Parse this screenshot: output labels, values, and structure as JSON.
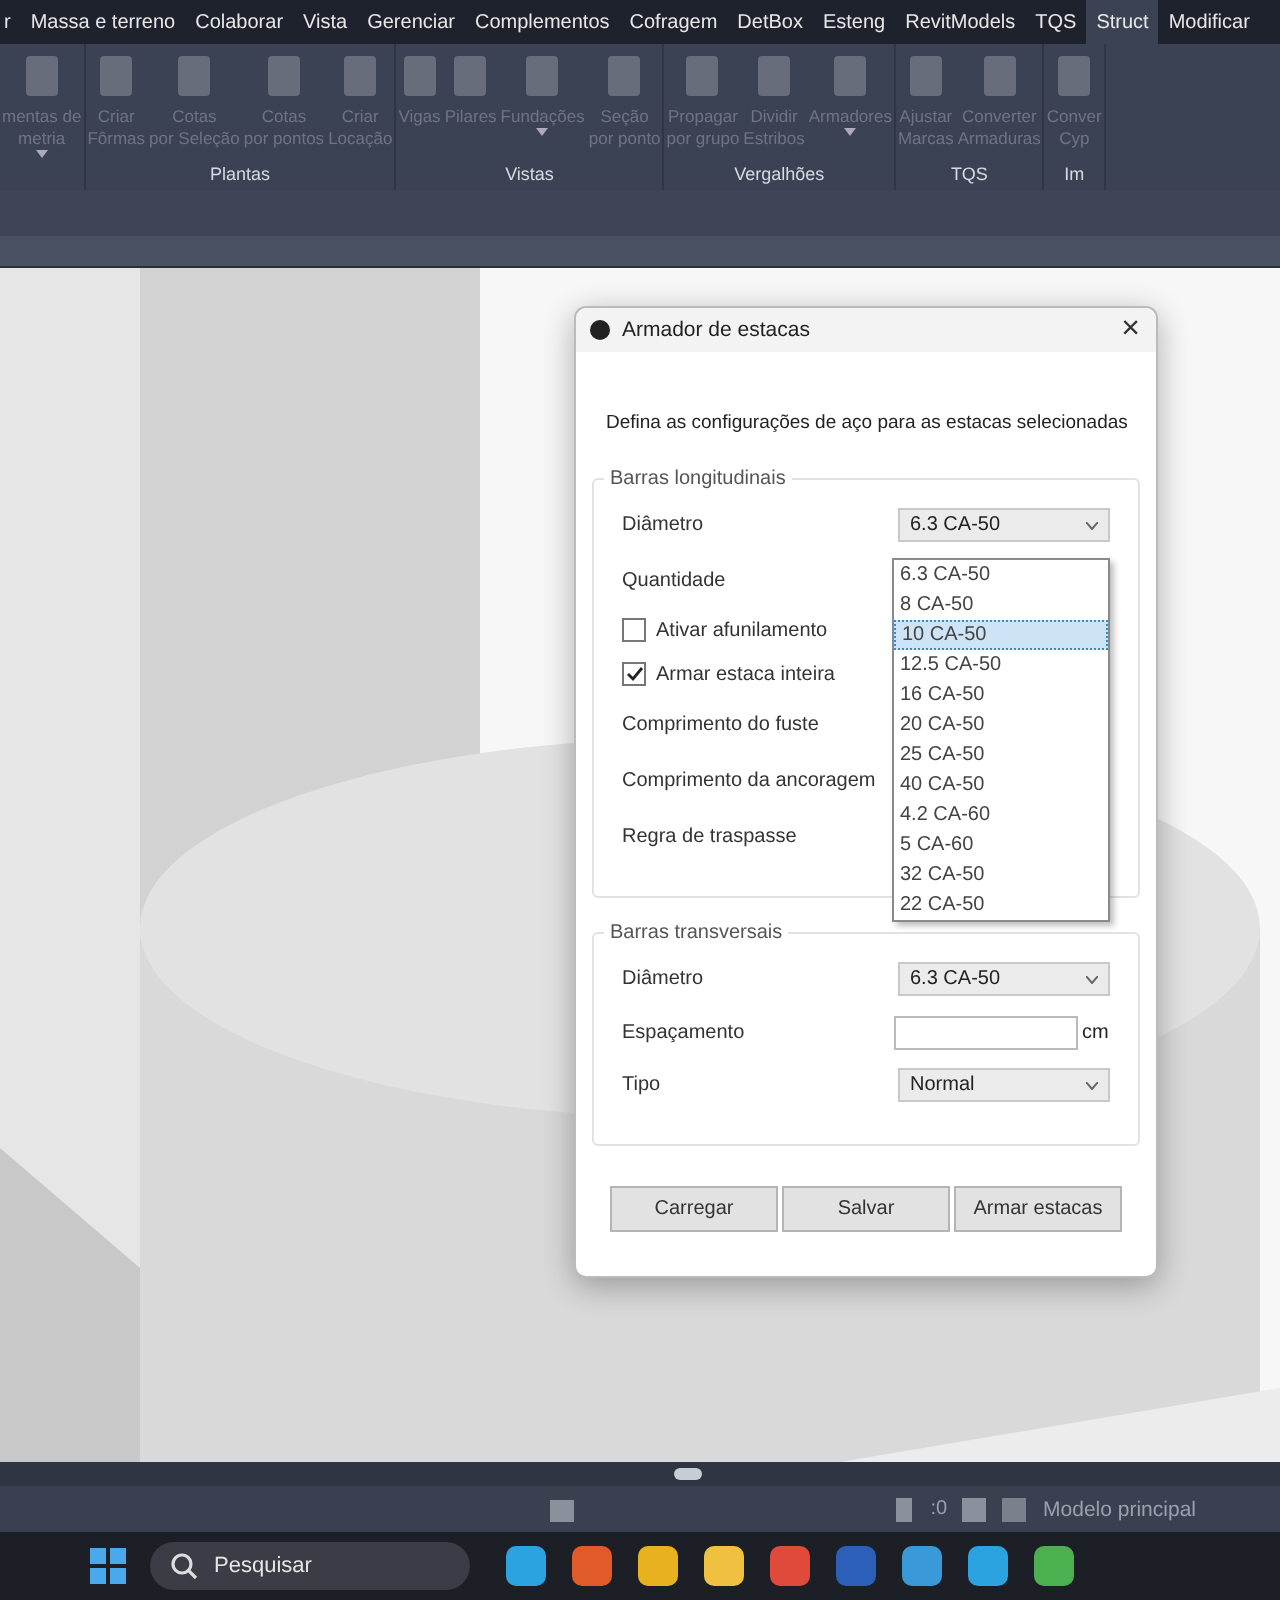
{
  "menu": [
    {
      "label": "r",
      "selected": false
    },
    {
      "label": "Massa e terreno",
      "selected": false
    },
    {
      "label": "Colaborar",
      "selected": false
    },
    {
      "label": "Vista",
      "selected": false
    },
    {
      "label": "Gerenciar",
      "selected": false
    },
    {
      "label": "Complementos",
      "selected": false
    },
    {
      "label": "Cofragem",
      "selected": false
    },
    {
      "label": "DetBox",
      "selected": false
    },
    {
      "label": "Esteng",
      "selected": false
    },
    {
      "label": "RevitModels",
      "selected": false
    },
    {
      "label": "TQS",
      "selected": false
    },
    {
      "label": "Struct",
      "selected": true
    },
    {
      "label": "Modificar",
      "selected": false
    }
  ],
  "ribbon": [
    {
      "tools": [
        {
          "lines": [
            "mentas de",
            "metria"
          ],
          "caret": true,
          "disabled": true
        }
      ]
    },
    {
      "label": "Plantas",
      "tools": [
        {
          "lines": [
            "Criar",
            "Fôrmas"
          ],
          "caret": false,
          "disabled": true
        },
        {
          "lines": [
            "Cotas",
            "por Seleção"
          ],
          "caret": false,
          "disabled": true
        },
        {
          "lines": [
            "Cotas",
            "por pontos"
          ],
          "caret": false,
          "disabled": true
        },
        {
          "lines": [
            "Criar",
            "Locação"
          ],
          "caret": false,
          "disabled": true
        }
      ]
    },
    {
      "label": "Vistas",
      "tools": [
        {
          "lines": [
            "Vigas"
          ],
          "caret": false,
          "disabled": true
        },
        {
          "lines": [
            "Pilares"
          ],
          "caret": false,
          "disabled": true
        },
        {
          "lines": [
            "Fundações"
          ],
          "caret": true,
          "disabled": true
        },
        {
          "lines": [
            "Seção",
            "por ponto"
          ],
          "caret": false,
          "disabled": true
        }
      ]
    },
    {
      "label": "Vergalhões",
      "tools": [
        {
          "lines": [
            "Propagar",
            "por grupo"
          ],
          "caret": false,
          "disabled": true
        },
        {
          "lines": [
            "Dividir",
            "Estribos"
          ],
          "caret": false,
          "disabled": true
        },
        {
          "lines": [
            "Armadores"
          ],
          "caret": true,
          "disabled": true
        }
      ]
    },
    {
      "label": "TQS",
      "tools": [
        {
          "lines": [
            "Ajustar",
            "Marcas"
          ],
          "caret": false,
          "disabled": true
        },
        {
          "lines": [
            "Converter",
            "Armaduras"
          ],
          "caret": false,
          "disabled": true
        }
      ]
    },
    {
      "label": "Im",
      "tools": [
        {
          "lines": [
            "Conver",
            "Cyp"
          ],
          "caret": false,
          "disabled": true
        }
      ]
    }
  ],
  "dialog": {
    "title": "Armador de estacas",
    "close": "×",
    "description": "Defina as configurações de aço para as estacas selecionadas",
    "groups": [
      {
        "legend": "Barras longitudinais",
        "rows": [
          {
            "kind": "combo",
            "label": "Diâmetro",
            "value": "6.3 CA-50"
          },
          {
            "kind": "label",
            "label": "Quantidade"
          },
          {
            "kind": "checkbox",
            "label": "Ativar afunilamento",
            "checked": false
          },
          {
            "kind": "checkbox",
            "label": "Armar estaca inteira",
            "checked": true
          },
          {
            "kind": "label",
            "label": "Comprimento do fuste"
          },
          {
            "kind": "label",
            "label": "Comprimento da ancoragem"
          },
          {
            "kind": "label",
            "label": "Regra de traspasse"
          }
        ]
      },
      {
        "legend": "Barras transversais",
        "rows": [
          {
            "kind": "combo",
            "label": "Diâmetro",
            "value": "6.3 CA-50"
          },
          {
            "kind": "field",
            "label": "Espaçamento",
            "unit": "cm"
          },
          {
            "kind": "combo",
            "label": "Tipo",
            "value": "Normal"
          }
        ]
      }
    ],
    "dropdown": [
      {
        "label": "6.3 CA-50",
        "selected": false
      },
      {
        "label": "8 CA-50",
        "selected": false
      },
      {
        "label": "10 CA-50",
        "selected": true
      },
      {
        "label": "12.5 CA-50",
        "selected": false
      },
      {
        "label": "16 CA-50",
        "selected": false
      },
      {
        "label": "20 CA-50",
        "selected": false
      },
      {
        "label": "25 CA-50",
        "selected": false
      },
      {
        "label": "40 CA-50",
        "selected": false
      },
      {
        "label": "4.2 CA-60",
        "selected": false
      },
      {
        "label": "5 CA-60",
        "selected": false
      },
      {
        "label": "32 CA-50",
        "selected": false
      },
      {
        "label": "22 CA-50",
        "selected": false
      }
    ],
    "buttons": [
      "Carregar",
      "Salvar",
      "Armar estacas"
    ]
  },
  "status_bar": {
    "counter": ":0",
    "model": "Modelo principal"
  },
  "taskbar": {
    "search": {
      "placeholder": "Pesquisar"
    }
  }
}
